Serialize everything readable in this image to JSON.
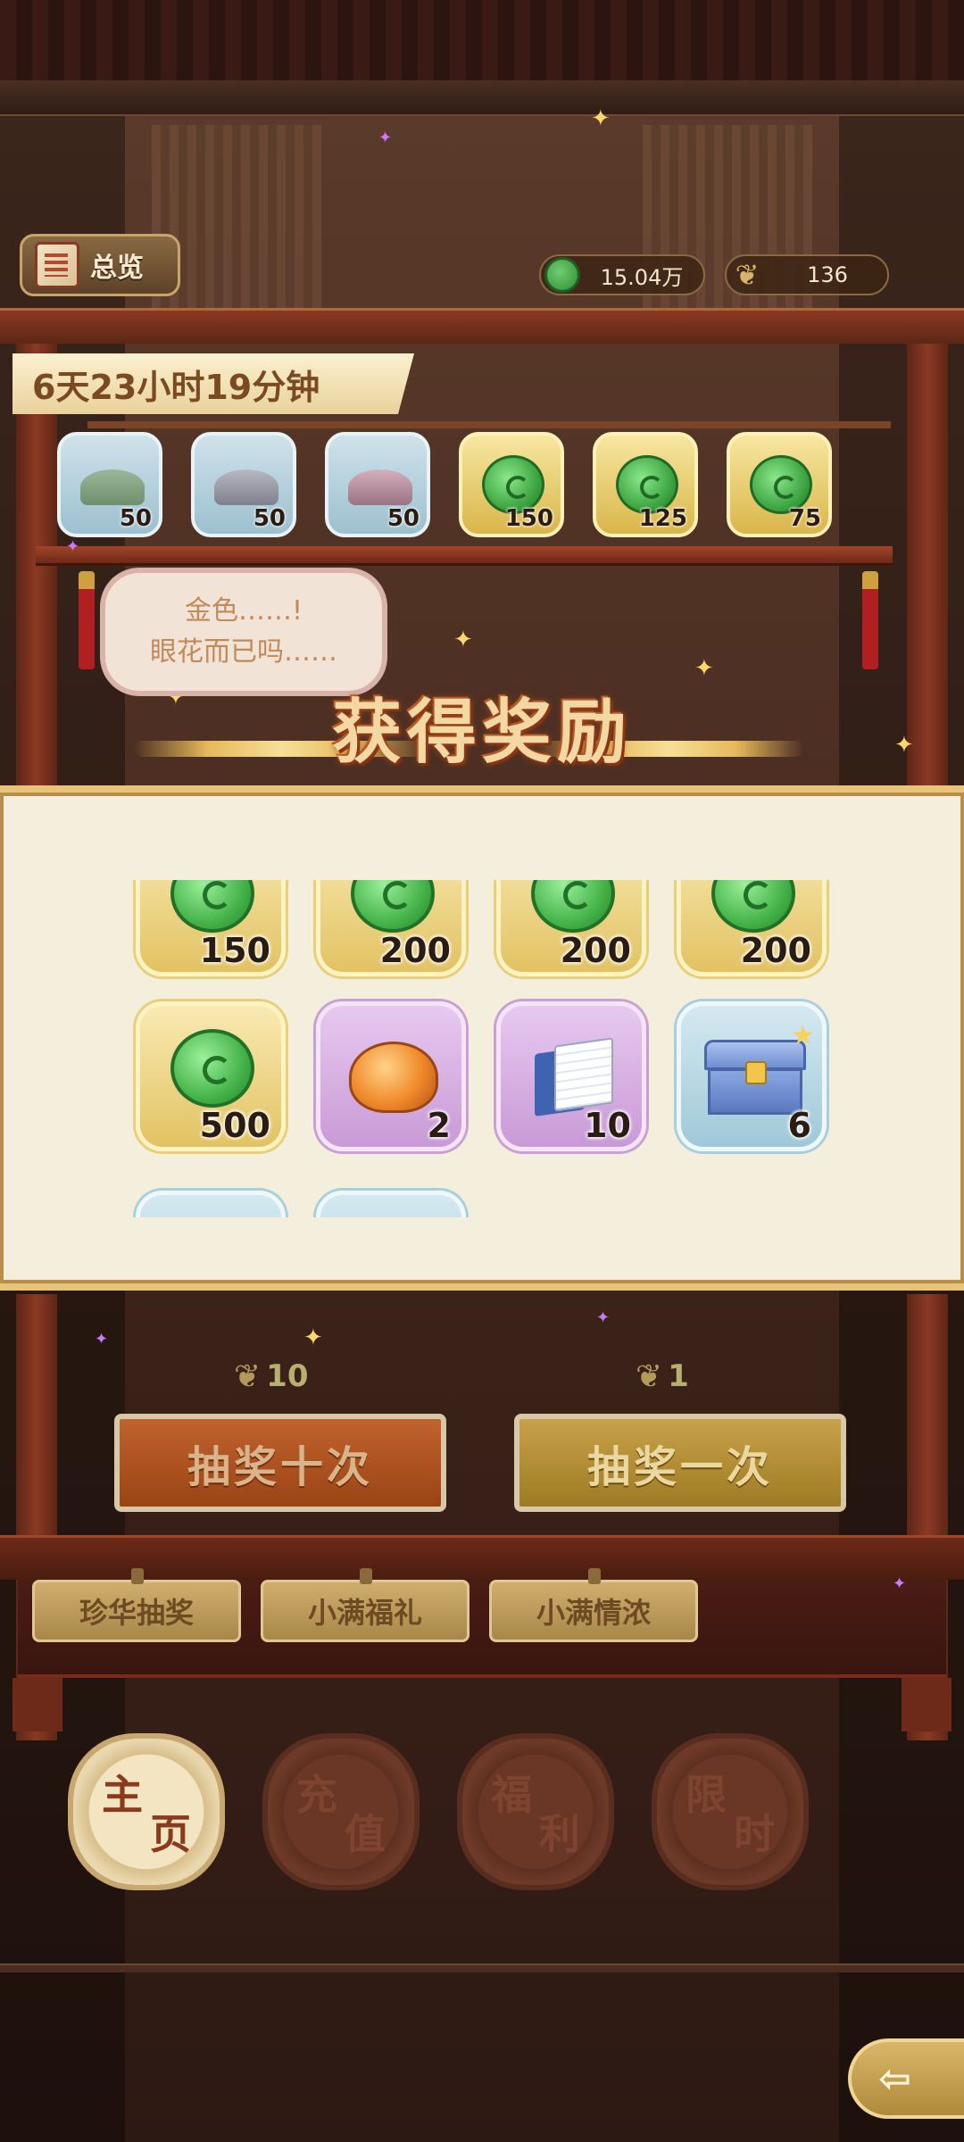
{
  "header": {
    "overview_label": "总览",
    "currency_jade": "15.04万",
    "currency_feather": "136"
  },
  "timer": "6天23小时19分钟",
  "shelf": [
    {
      "kind": "powder",
      "tone": "blue",
      "qty": "50"
    },
    {
      "kind": "powder",
      "tone": "blue",
      "qty": "50"
    },
    {
      "kind": "powder",
      "tone": "blue",
      "qty": "50"
    },
    {
      "kind": "jade",
      "tone": "gold",
      "qty": "150"
    },
    {
      "kind": "jade",
      "tone": "gold",
      "qty": "125"
    },
    {
      "kind": "jade",
      "tone": "gold",
      "qty": "75"
    }
  ],
  "bubble": {
    "line1": "金色……!",
    "line2": "眼花而已吗……"
  },
  "reward": {
    "title": "获得奖励",
    "items": [
      {
        "icon": "jade-icon",
        "rarity": "gold",
        "qty": "150"
      },
      {
        "icon": "jade-icon",
        "rarity": "gold",
        "qty": "200"
      },
      {
        "icon": "jade-icon",
        "rarity": "gold",
        "qty": "200"
      },
      {
        "icon": "jade-icon",
        "rarity": "gold",
        "qty": "200"
      },
      {
        "icon": "jade-icon",
        "rarity": "gold",
        "qty": "500"
      },
      {
        "icon": "amber-stone-icon",
        "rarity": "purple",
        "qty": "2"
      },
      {
        "icon": "scroll-book-icon",
        "rarity": "purple",
        "qty": "10"
      },
      {
        "icon": "treasure-chest-icon",
        "rarity": "blue",
        "qty": "6"
      },
      {
        "icon": "unknown",
        "rarity": "blue",
        "qty": ""
      },
      {
        "icon": "unknown",
        "rarity": "blue",
        "qty": ""
      }
    ]
  },
  "draw": {
    "ten_cost": "10",
    "one_cost": "1",
    "ten_label": "抽奖十次",
    "one_label": "抽奖一次"
  },
  "tabs": [
    "珍华抽奖",
    "小满福礼",
    "小满情浓"
  ],
  "nav": [
    {
      "c1": "主",
      "c2": "页",
      "active": true
    },
    {
      "c1": "充",
      "c2": "值",
      "active": false
    },
    {
      "c1": "福",
      "c2": "利",
      "active": false
    },
    {
      "c1": "限",
      "c2": "时",
      "active": false
    }
  ],
  "colors": {
    "jade": "#45b449",
    "gold_frame": "#e2c263",
    "purple_frame": "#c89ad6",
    "blue_frame": "#9fc8d8",
    "draw_ten": "#c0632e",
    "draw_one": "#c8a24a",
    "panel_bg": "#f4eedd"
  }
}
